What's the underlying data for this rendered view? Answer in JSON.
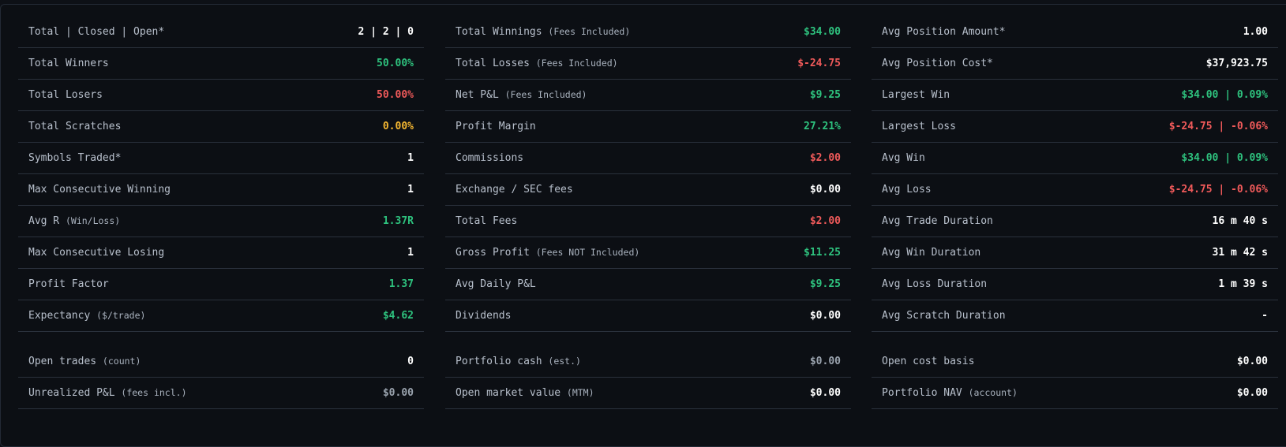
{
  "colors": {
    "green": "#2ec27e",
    "red": "#f05a5a",
    "orange": "#f5b731",
    "white": "#ffffff",
    "muted": "#9aa3ae"
  },
  "col1": [
    {
      "label": "Total | Closed | Open*",
      "sub": "",
      "value": "2 | 2 | 0",
      "tone": "white"
    },
    {
      "label": "Total Winners",
      "sub": "",
      "value": "50.00%",
      "tone": "green"
    },
    {
      "label": "Total Losers",
      "sub": "",
      "value": "50.00%",
      "tone": "red"
    },
    {
      "label": "Total Scratches",
      "sub": "",
      "value": "0.00%",
      "tone": "orange"
    },
    {
      "label": "Symbols Traded*",
      "sub": "",
      "value": "1",
      "tone": "white"
    },
    {
      "label": "Max Consecutive Winning",
      "sub": "",
      "value": "1",
      "tone": "white"
    },
    {
      "label": "Avg R",
      "sub": "(Win/Loss)",
      "value": "1.37R",
      "tone": "green"
    },
    {
      "label": "Max Consecutive Losing",
      "sub": "",
      "value": "1",
      "tone": "white"
    },
    {
      "label": "Profit Factor",
      "sub": "",
      "value": "1.37",
      "tone": "green"
    },
    {
      "label": "Expectancy",
      "sub": "($/trade)",
      "value": "$4.62",
      "tone": "green"
    }
  ],
  "col1_open": [
    {
      "label": "Open trades",
      "sub": "(count)",
      "value": "0",
      "tone": "white"
    },
    {
      "label": "Unrealized P&L",
      "sub": "(fees incl.)",
      "value": "$0.00",
      "tone": "muted"
    }
  ],
  "col2": [
    {
      "label": "Total Winnings",
      "sub": "(Fees Included)",
      "value": "$34.00",
      "tone": "green"
    },
    {
      "label": "Total Losses",
      "sub": "(Fees Included)",
      "value": "$-24.75",
      "tone": "red"
    },
    {
      "label": "Net P&L",
      "sub": "(Fees Included)",
      "value": "$9.25",
      "tone": "green"
    },
    {
      "label": "Profit Margin",
      "sub": "",
      "value": "27.21%",
      "tone": "green"
    },
    {
      "label": "Commissions",
      "sub": "",
      "value": "$2.00",
      "tone": "red"
    },
    {
      "label": "Exchange / SEC fees",
      "sub": "",
      "value": "$0.00",
      "tone": "white"
    },
    {
      "label": "Total Fees",
      "sub": "",
      "value": "$2.00",
      "tone": "red"
    },
    {
      "label": "Gross Profit",
      "sub": "(Fees NOT Included)",
      "value": "$11.25",
      "tone": "green"
    },
    {
      "label": "Avg Daily P&L",
      "sub": "",
      "value": "$9.25",
      "tone": "green"
    },
    {
      "label": "Dividends",
      "sub": "",
      "value": "$0.00",
      "tone": "white"
    }
  ],
  "col2_open": [
    {
      "label": "Portfolio cash",
      "sub": "(est.)",
      "value": "$0.00",
      "tone": "muted"
    },
    {
      "label": "Open market value",
      "sub": "(MTM)",
      "value": "$0.00",
      "tone": "white"
    }
  ],
  "col3": [
    {
      "label": "Avg Position Amount*",
      "sub": "",
      "value": "1.00",
      "tone": "white"
    },
    {
      "label": "Avg Position Cost*",
      "sub": "",
      "value": "$37,923.75",
      "tone": "white"
    },
    {
      "label": "Largest Win",
      "sub": "",
      "value": "$34.00 | 0.09%",
      "tone": "green"
    },
    {
      "label": "Largest Loss",
      "sub": "",
      "value": "$-24.75 | -0.06%",
      "tone": "red"
    },
    {
      "label": "Avg Win",
      "sub": "",
      "value": "$34.00 | 0.09%",
      "tone": "green"
    },
    {
      "label": "Avg Loss",
      "sub": "",
      "value": "$-24.75 | -0.06%",
      "tone": "red"
    },
    {
      "label": "Avg Trade Duration",
      "sub": "",
      "value": "16 m 40 s",
      "tone": "white"
    },
    {
      "label": "Avg Win Duration",
      "sub": "",
      "value": "31 m 42 s",
      "tone": "white"
    },
    {
      "label": "Avg Loss Duration",
      "sub": "",
      "value": "1 m 39 s",
      "tone": "white"
    },
    {
      "label": "Avg Scratch Duration",
      "sub": "",
      "value": "-",
      "tone": "white"
    }
  ],
  "col3_open": [
    {
      "label": "Open cost basis",
      "sub": "",
      "value": "$0.00",
      "tone": "white"
    },
    {
      "label": "Portfolio NAV",
      "sub": "(account)",
      "value": "$0.00",
      "tone": "white"
    }
  ]
}
